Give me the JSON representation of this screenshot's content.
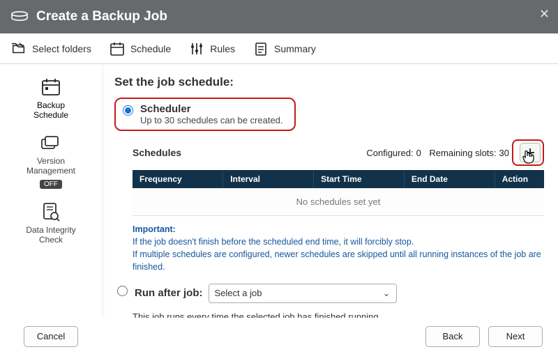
{
  "window": {
    "title": "Create a Backup Job"
  },
  "steps": [
    {
      "label": "Select folders"
    },
    {
      "label": "Schedule"
    },
    {
      "label": "Rules"
    },
    {
      "label": "Summary"
    }
  ],
  "sidebar": {
    "items": [
      {
        "label": "Backup\nSchedule"
      },
      {
        "label": "Version\nManagement",
        "badge": "OFF"
      },
      {
        "label": "Data Integrity\nCheck"
      }
    ]
  },
  "content": {
    "heading": "Set the job schedule:",
    "scheduler": {
      "label": "Scheduler",
      "sub": "Up to 30 schedules can be created."
    },
    "schedules": {
      "title": "Schedules",
      "configured_label": "Configured:",
      "configured_value": "0",
      "remaining_label": "Remaining slots:",
      "remaining_value": "30",
      "columns": [
        "Frequency",
        "Interval",
        "Start Time",
        "End Date",
        "Action"
      ],
      "empty_text": "No schedules set yet"
    },
    "important": {
      "title": "Important:",
      "line1": "If the job doesn't finish before the scheduled end time, it will forcibly stop.",
      "line2": "If multiple schedules are configured, newer schedules are skipped until all running instances of the job are finished."
    },
    "run_after": {
      "label": "Run after job:",
      "select_placeholder": "Select a job",
      "sub": "This job runs every time the selected job has finished running."
    }
  },
  "footer": {
    "cancel": "Cancel",
    "back": "Back",
    "next": "Next"
  }
}
